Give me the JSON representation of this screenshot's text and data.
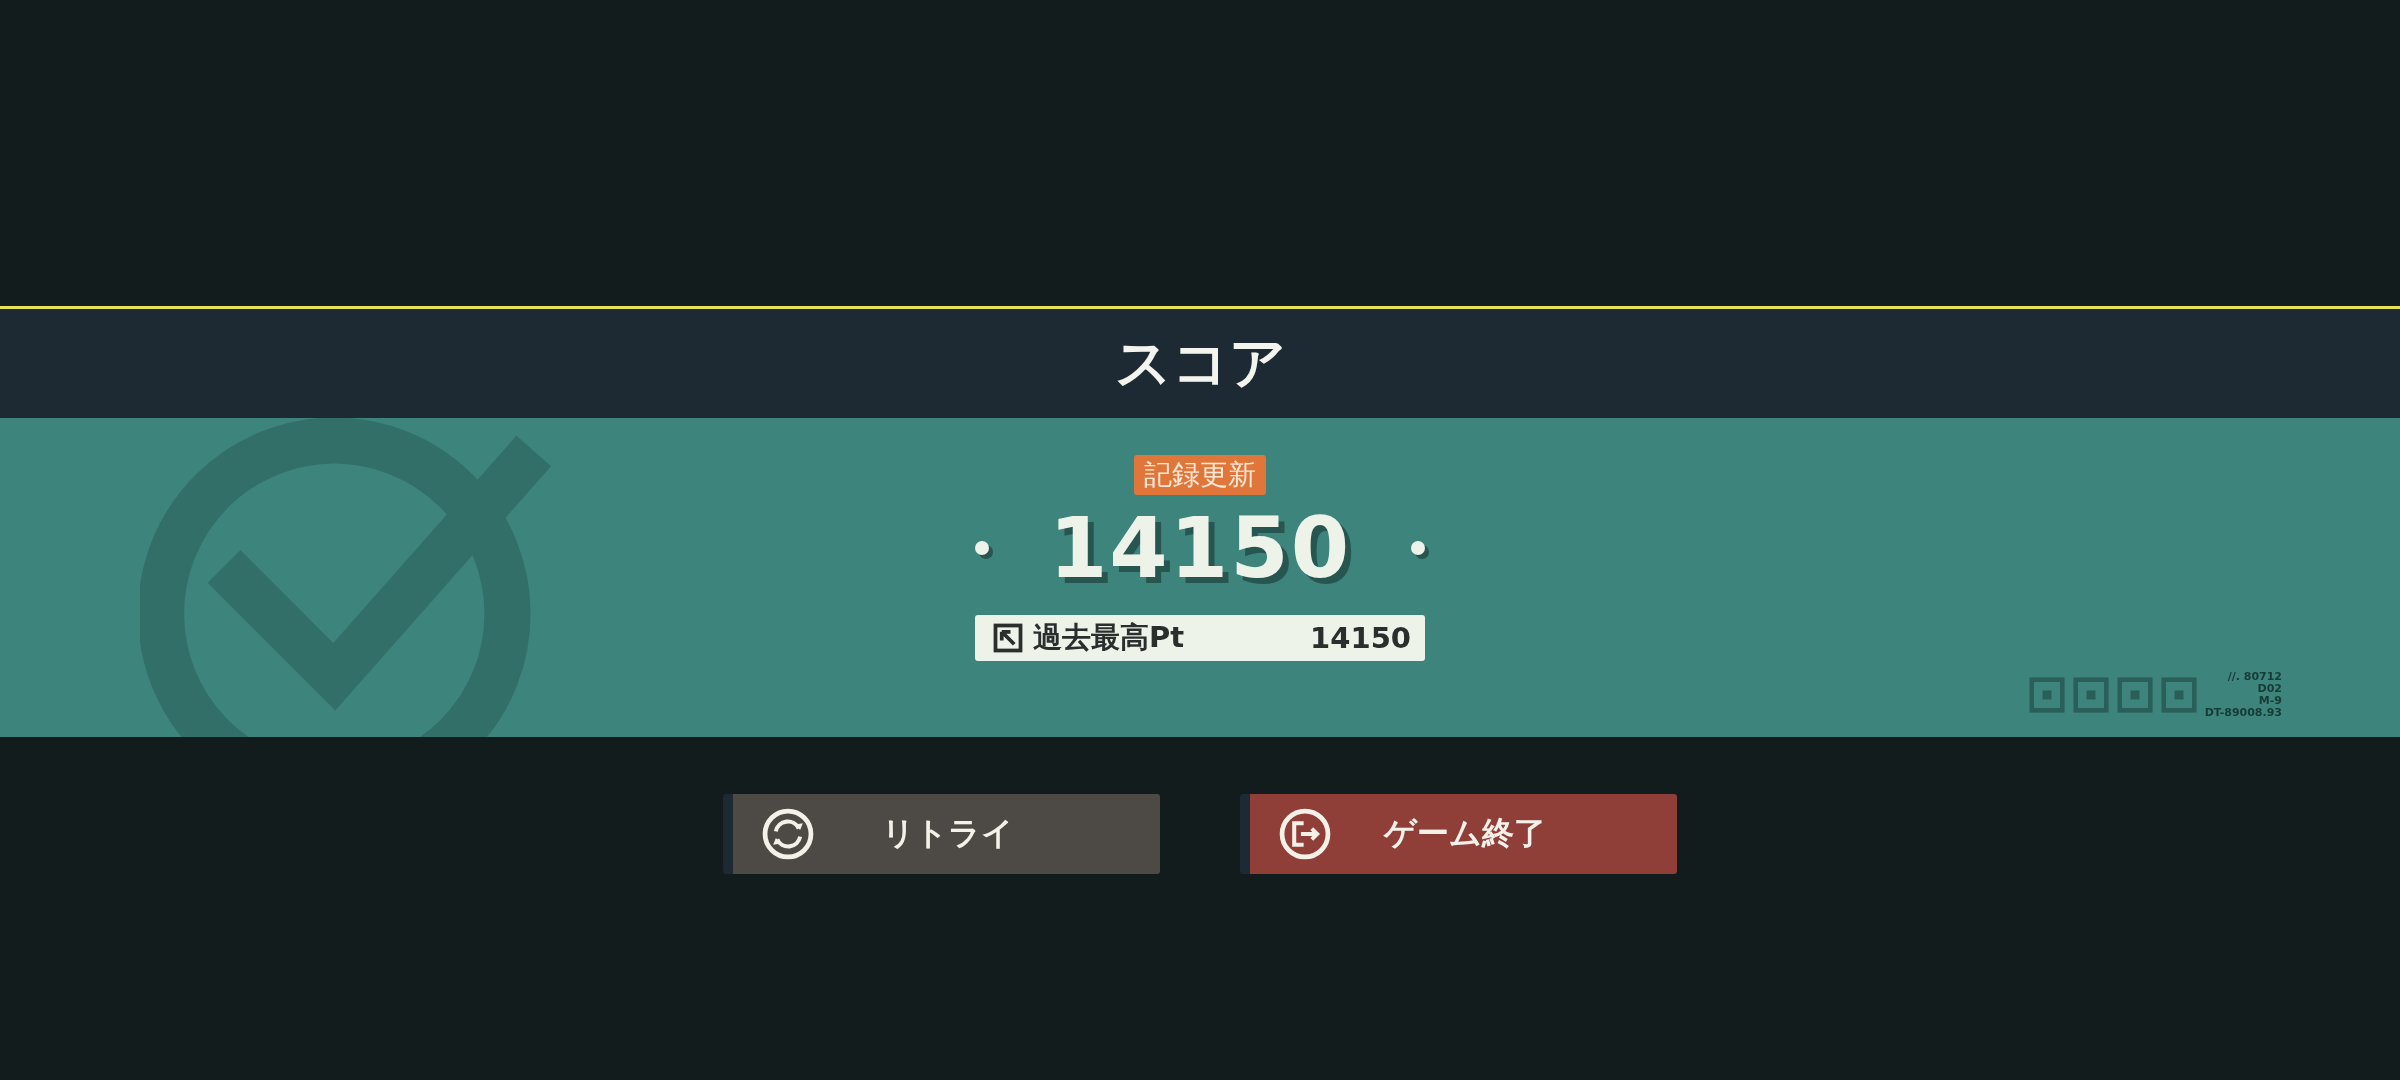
{
  "header": {
    "title": "スコア"
  },
  "result": {
    "badge": "記録更新",
    "score": "14150",
    "best": {
      "label": "過去最高Pt",
      "value": "14150"
    }
  },
  "codes": [
    "//. 80712",
    "D02",
    "M-9",
    "DT-89008.93"
  ],
  "buttons": [
    {
      "label": "リトライ",
      "kind": "retry"
    },
    {
      "label": "ゲーム終了",
      "kind": "quit"
    }
  ]
}
